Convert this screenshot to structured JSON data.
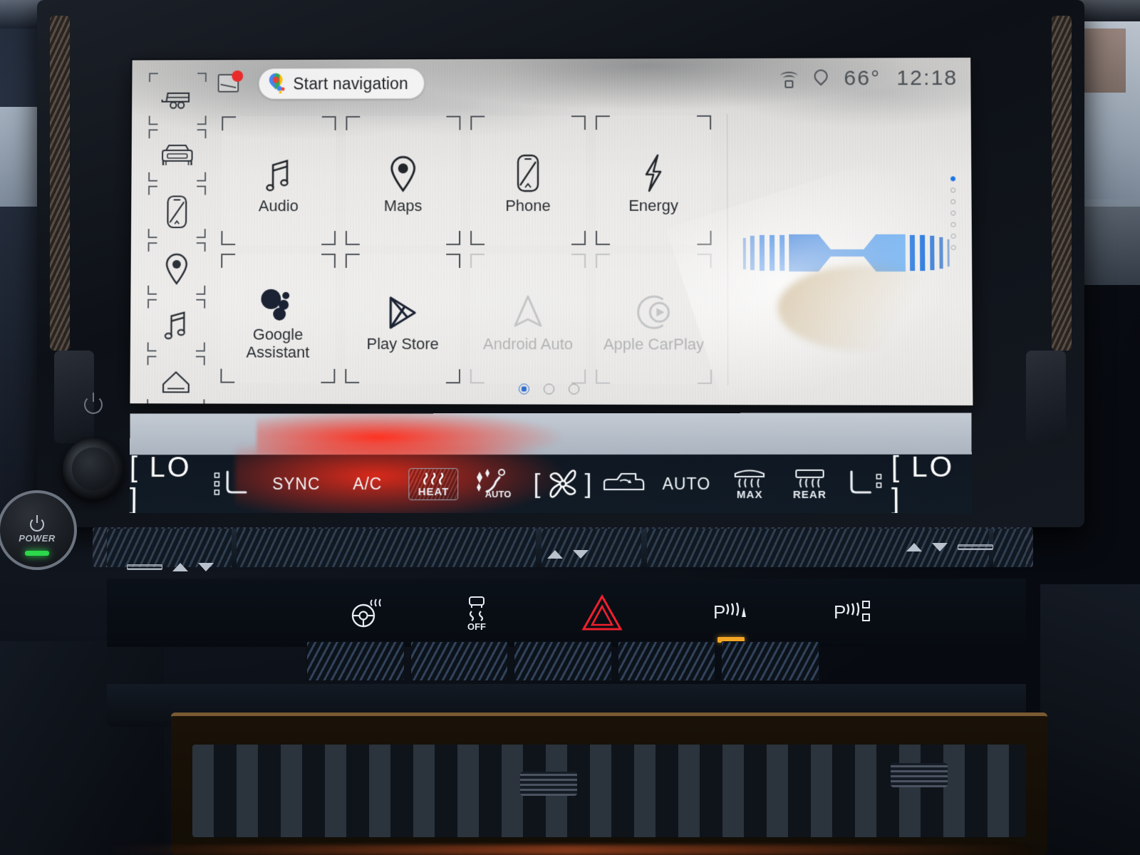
{
  "screen": {
    "status_bar": {
      "nav_pill": {
        "label": "Start navigation",
        "icon": "google-maps-pin-icon"
      },
      "message_icon": "message-notification-icon",
      "wifi_icon": "wifi-hotspot-icon",
      "location_icon": "location-pin-icon",
      "temperature": "66°",
      "time": "12:18"
    },
    "left_rail": [
      {
        "name": "trailer",
        "icon": "trailer-icon"
      },
      {
        "name": "vehicle",
        "icon": "vehicle-front-icon"
      },
      {
        "name": "phone",
        "icon": "phone-projection-icon"
      },
      {
        "name": "maps",
        "icon": "location-pin-icon"
      },
      {
        "name": "audio",
        "icon": "music-note-icon"
      },
      {
        "name": "home",
        "icon": "home-icon"
      }
    ],
    "app_grid": {
      "row1": [
        {
          "label": "Audio",
          "icon": "music-note-icon",
          "enabled": true
        },
        {
          "label": "Maps",
          "icon": "location-pin-icon",
          "enabled": true
        },
        {
          "label": "Phone",
          "icon": "phone-projection-icon",
          "enabled": true
        },
        {
          "label": "Energy",
          "icon": "lightning-bolt-icon",
          "enabled": true
        }
      ],
      "row2": [
        {
          "label": "Google Assistant",
          "icon": "google-assistant-icon",
          "enabled": true
        },
        {
          "label": "Play Store",
          "icon": "google-play-icon",
          "enabled": true
        },
        {
          "label": "Android Auto",
          "icon": "android-auto-icon",
          "enabled": false
        },
        {
          "label": "Apple CarPlay",
          "icon": "apple-carplay-icon",
          "enabled": false
        }
      ]
    },
    "widget": {
      "name": "energy-flow-widget",
      "accent_color": "#1567d3",
      "bar_count_left": 5,
      "bar_count_right": 5
    },
    "page_dots": {
      "total": 3,
      "active_index": 0
    },
    "side_dots": {
      "total": 7,
      "active_index": 0
    }
  },
  "climate": {
    "left": {
      "temperature": "[ LO ]",
      "seat_icon": "heated-seat-icon"
    },
    "sync_label": "SYNC",
    "ac_label": "A/C",
    "heat": {
      "label": "HEAT",
      "icon": "seat-heat-waves-icon",
      "active": true
    },
    "auto_seat": {
      "label": "AUTO",
      "icon": "auto-comfort-icon"
    },
    "fan": {
      "icon": "fan-blade-icon"
    },
    "recirculate": {
      "icon": "air-recirculation-icon"
    },
    "auto_label": "AUTO",
    "max_defrost": {
      "label": "MAX",
      "icon": "front-defrost-icon"
    },
    "rear_defrost": {
      "label": "REAR",
      "icon": "rear-defrost-icon"
    },
    "right": {
      "temperature": "[ LO ]",
      "seat_icon": "heated-seat-icon"
    }
  },
  "physical_controls": {
    "bezel": {
      "power_glyph": "power-icon",
      "volume_knob": "volume-knob",
      "power_button": {
        "label": "POWER",
        "icon": "power-icon",
        "indicator_color": "#2bd94a"
      }
    },
    "buttons": [
      {
        "name": "heated-steering-wheel",
        "icon": "heated-steering-wheel-icon",
        "indicator": false
      },
      {
        "name": "traction-control-off",
        "icon": "traction-control-off-icon",
        "sub_label": "OFF",
        "indicator": false
      },
      {
        "name": "hazard-lights",
        "icon": "hazard-triangle-icon",
        "color": "#f01f2e",
        "indicator": false
      },
      {
        "name": "park-assist-front",
        "icon": "park-assist-icon",
        "indicator": true,
        "indicator_color": "#f5a524"
      },
      {
        "name": "park-assist-rear",
        "icon": "park-assist-camera-icon",
        "indicator": false
      }
    ],
    "temp_steppers": [
      {
        "name": "driver-temp-stepper",
        "up": "△",
        "down": "▽"
      },
      {
        "name": "center-temp-stepper",
        "up": "△",
        "down": "▽"
      },
      {
        "name": "passenger-temp-stepper",
        "up": "△",
        "down": "▽"
      }
    ]
  }
}
